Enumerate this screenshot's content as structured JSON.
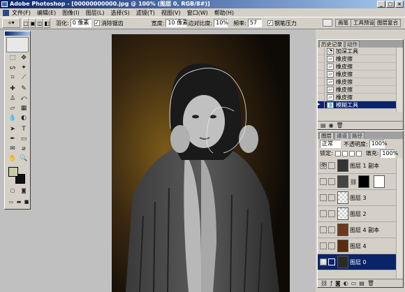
{
  "window": {
    "title": "Adobe Photoshop - [00000000000.jpg @ 100% (图层 0, RGB/8#)]",
    "buttons": [
      "_",
      "□",
      "×"
    ]
  },
  "menu": [
    "文件(F)",
    "编辑(E)",
    "图像(I)",
    "图层(L)",
    "选择(S)",
    "滤镜(T)",
    "视图(V)",
    "窗口(W)",
    "帮助(H)"
  ],
  "options": {
    "feather_label": "羽化:",
    "feather_value": "0 像素",
    "antialias_label": "消除锯齿",
    "width_label": "宽度:",
    "width_value": "10 像素",
    "contrast_label": "边对比度:",
    "contrast_value": "10%",
    "freq_label": "频率:",
    "freq_value": "57",
    "pen_label": "钢笔压力",
    "right_tabs": [
      "画笔",
      "工具预设",
      "图层复合"
    ]
  },
  "history": {
    "tabs": [
      "历史记录",
      "动作"
    ],
    "items": [
      {
        "label": "加深工具",
        "selected": false
      },
      {
        "label": "橡皮擦",
        "selected": false
      },
      {
        "label": "橡皮擦",
        "selected": false
      },
      {
        "label": "橡皮擦",
        "selected": false
      },
      {
        "label": "橡皮擦",
        "selected": false
      },
      {
        "label": "橡皮擦",
        "selected": false
      },
      {
        "label": "橡皮擦",
        "selected": false
      },
      {
        "label": "模糊工具",
        "selected": true
      }
    ]
  },
  "layers": {
    "tabs": [
      "图层",
      "通道",
      "路径"
    ],
    "blend_mode": "正常",
    "opacity_label": "不透明度:",
    "opacity_value": "100%",
    "lock_label": "锁定:",
    "fill_label": "填充:",
    "fill_value": "100%",
    "items": [
      {
        "name": "图层 1 副本",
        "visible": true,
        "selected": false,
        "mask": false
      },
      {
        "name": "",
        "visible": false,
        "selected": false,
        "mask": true
      },
      {
        "name": "图层 3",
        "visible": false,
        "selected": false,
        "mask": false
      },
      {
        "name": "图层 2",
        "visible": false,
        "selected": false,
        "mask": false
      },
      {
        "name": "图层 4 副本",
        "visible": false,
        "selected": false,
        "mask": false
      },
      {
        "name": "图层 4",
        "visible": false,
        "selected": false,
        "mask": false
      },
      {
        "name": "图层 0",
        "visible": true,
        "selected": true,
        "mask": false
      }
    ],
    "footer_icons": [
      "link-icon",
      "fx-icon",
      "mask-icon",
      "adjustment-icon",
      "folder-icon",
      "new-layer-icon",
      "trash-icon"
    ]
  },
  "colors": {
    "foreground": "#c8cca8",
    "background": "#111111",
    "accent": "#0a246a"
  }
}
